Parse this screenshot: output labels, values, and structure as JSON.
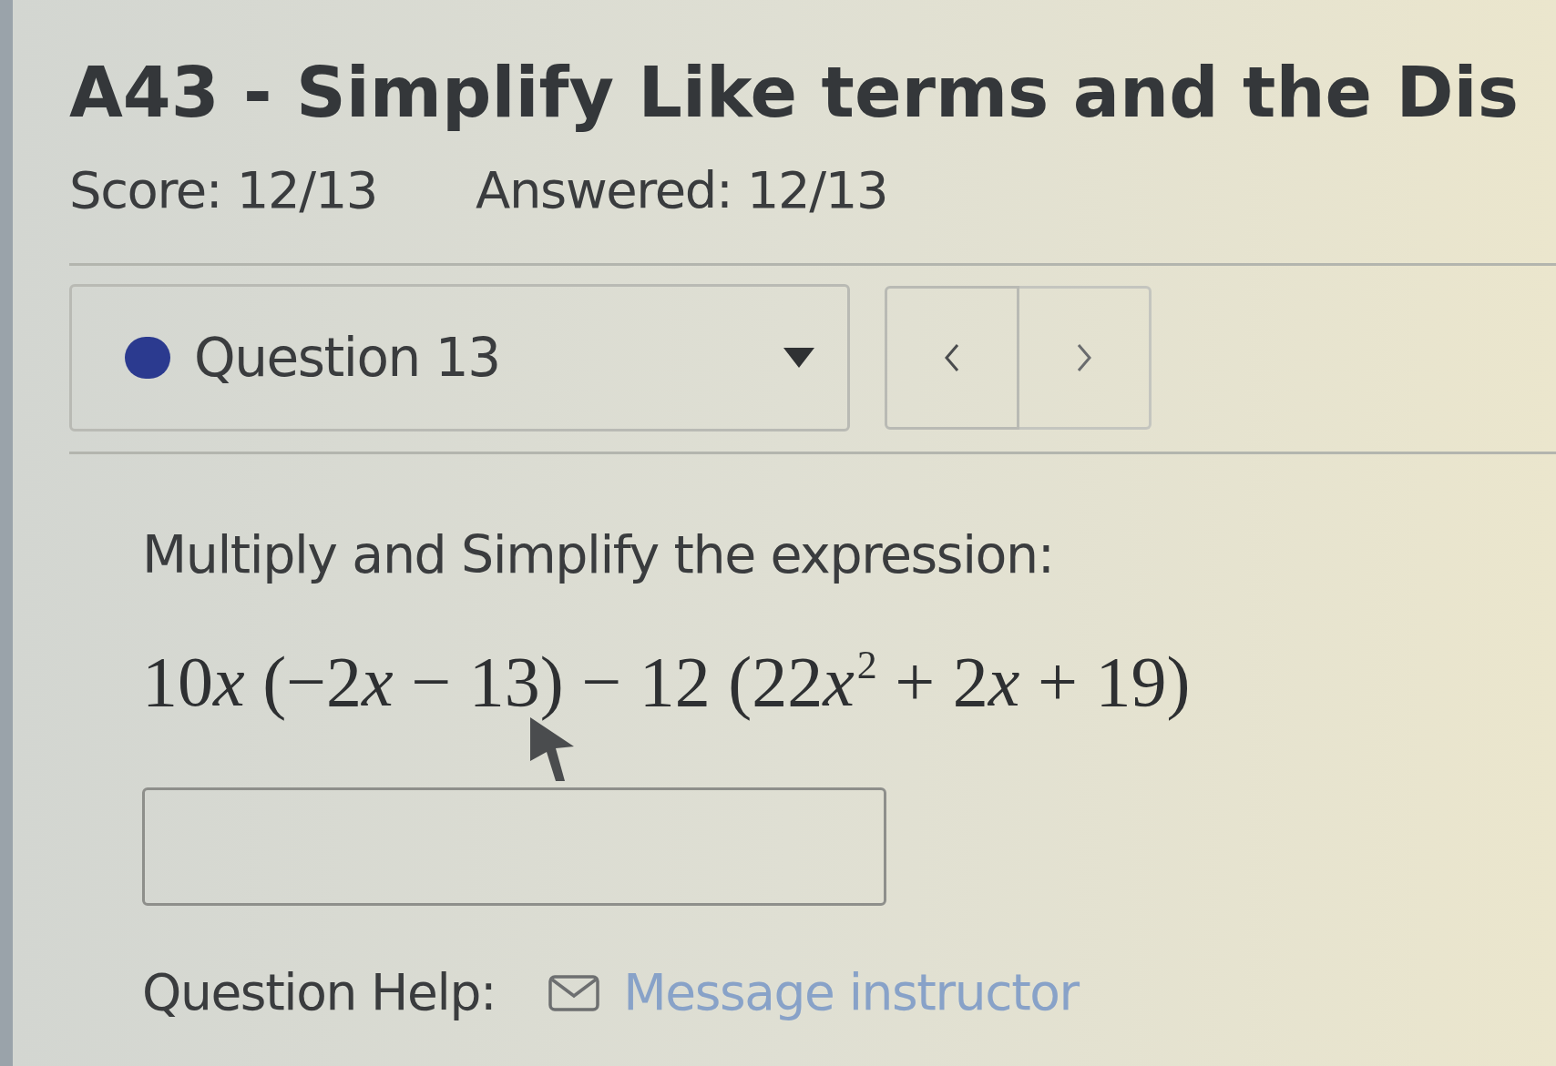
{
  "assignment": {
    "title": "A43 - Simplify Like terms and the Dis",
    "score": "Score: 12/13",
    "answered": "Answered: 12/13"
  },
  "question_select": {
    "label": "Question 13",
    "color": "#2b3a8f"
  },
  "question": {
    "prompt": "Multiply and Simplify the expression:",
    "expression": [
      {
        "kind": "text",
        "text": "10"
      },
      {
        "kind": "var",
        "text": "x"
      },
      {
        "kind": "text",
        "text": " (−2"
      },
      {
        "kind": "var",
        "text": "x"
      },
      {
        "kind": "text",
        "text": " − 13) − 12 (22"
      },
      {
        "kind": "var",
        "text": "x"
      },
      {
        "kind": "sup",
        "text": "2"
      },
      {
        "kind": "text",
        "text": " + 2"
      },
      {
        "kind": "var",
        "text": "x"
      },
      {
        "kind": "text",
        "text": " + 19)"
      }
    ]
  },
  "help": {
    "label": "Question Help:",
    "link": "Message instructor"
  }
}
